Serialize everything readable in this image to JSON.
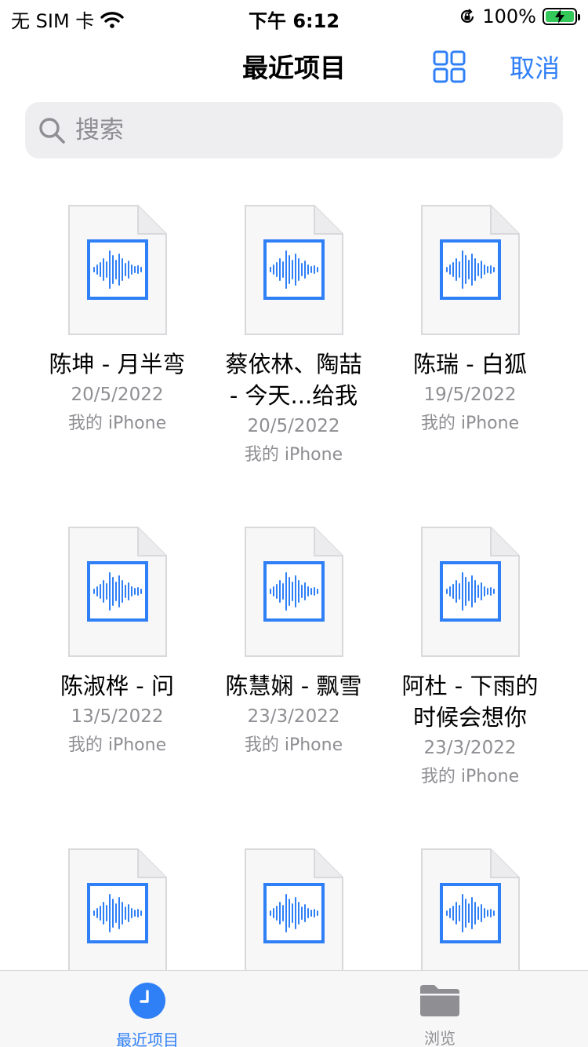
{
  "status_bar": {
    "carrier": "无 SIM 卡",
    "time": "下午 6:12",
    "battery_percent": "100%"
  },
  "nav": {
    "title": "最近项目",
    "cancel_label": "取消",
    "accent_color": "#2f7ff7"
  },
  "search": {
    "placeholder": "搜索",
    "value": ""
  },
  "files": [
    {
      "name": "陈坤 - 月半弯",
      "date": "20/5/2022",
      "location": "我的 iPhone"
    },
    {
      "name": "蔡依林、陶喆\n- 今天...给我",
      "date": "20/5/2022",
      "location": "我的 iPhone"
    },
    {
      "name": "陈瑞 - 白狐",
      "date": "19/5/2022",
      "location": "我的 iPhone"
    },
    {
      "name": "陈淑桦 - 问",
      "date": "13/5/2022",
      "location": "我的 iPhone"
    },
    {
      "name": "陈慧娴 - 飘雪",
      "date": "23/3/2022",
      "location": "我的 iPhone"
    },
    {
      "name": "阿杜 - 下雨的\n时候会想你",
      "date": "23/3/2022",
      "location": "我的 iPhone"
    },
    {
      "name": "",
      "date": "",
      "location": ""
    },
    {
      "name": "",
      "date": "",
      "location": ""
    },
    {
      "name": "",
      "date": "",
      "location": ""
    }
  ],
  "tabs": [
    {
      "label": "最近项目",
      "icon": "clock-icon",
      "selected": true
    },
    {
      "label": "浏览",
      "icon": "folder-icon",
      "selected": false
    }
  ]
}
